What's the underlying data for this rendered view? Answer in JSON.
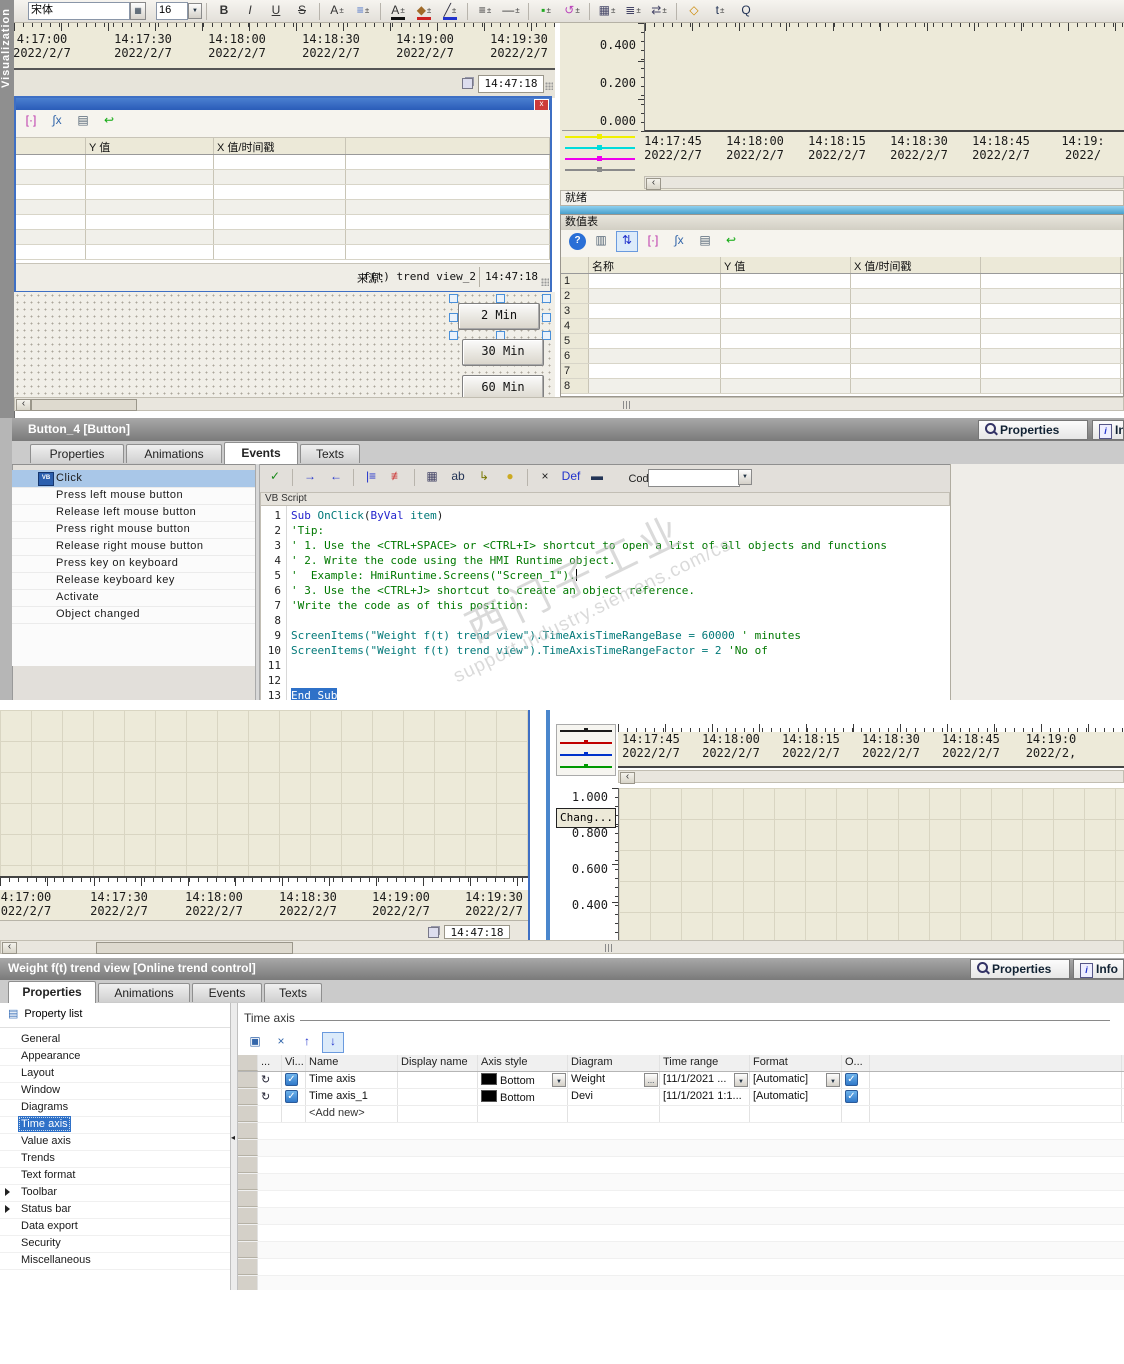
{
  "watermark": {
    "line1": "西门子工业",
    "line2": "support.industry.siemens.com/cs"
  },
  "toolbar": {
    "font_name": "宋体",
    "font_size": "16",
    "icons": [
      {
        "n": "bold-icon",
        "g": "B",
        "b": 1
      },
      {
        "n": "italic-icon",
        "g": "I",
        "i": 1
      },
      {
        "n": "underline-icon",
        "g": "U",
        "u": 1
      },
      {
        "n": "strikethrough-icon",
        "g": "S",
        "s": 1
      },
      {
        "n": "font-grow-icon",
        "g": "A",
        "pm": 1,
        "sep": 1
      },
      {
        "n": "align-icon",
        "g": "≡",
        "c": "#4a72c8",
        "pm": 1
      },
      {
        "n": "font-color-icon",
        "g": "A",
        "bar": "#111",
        "pm": 1,
        "sep": 1
      },
      {
        "n": "highlight-color-icon",
        "g": "◆",
        "c": "#a06a28",
        "bar": "#cc2222",
        "pm": 1
      },
      {
        "n": "pen-color-icon",
        "g": "╱",
        "c": "#334",
        "bar": "#2233cc",
        "pm": 1
      },
      {
        "n": "line-style-icon",
        "g": "≡",
        "pm": 1,
        "sep": 1
      },
      {
        "n": "line-width-icon",
        "g": "—",
        "pm": 1
      },
      {
        "n": "fill-color-icon",
        "g": "▪",
        "c": "#22aa22",
        "pm": 1,
        "sep": 1
      },
      {
        "n": "rotate-icon",
        "g": "↺",
        "c": "#bb44bb",
        "pm": 1
      },
      {
        "n": "grid-icon",
        "g": "▦",
        "c": "#446",
        "pm": 1,
        "sep": 1
      },
      {
        "n": "list-icon",
        "g": "≣",
        "c": "#446",
        "pm": 1
      },
      {
        "n": "flip-icon",
        "g": "⇄",
        "c": "#446",
        "pm": 1
      },
      {
        "n": "format-painter-icon",
        "g": "◇",
        "c": "#cc8800",
        "sep": 1
      },
      {
        "n": "text-rotate-icon",
        "g": "t",
        "c": "#235",
        "pm": 1
      },
      {
        "n": "find-icon",
        "g": "Q",
        "c": "#235"
      }
    ]
  },
  "sidebar": {
    "label": "Visualization"
  },
  "sec1": {
    "left_chart": {
      "labels": [
        {
          "t": "4:17:00",
          "d": "2022/2/7"
        },
        {
          "t": "14:17:30",
          "d": "2022/2/7"
        },
        {
          "t": "14:18:00",
          "d": "2022/2/7"
        },
        {
          "t": "14:18:30",
          "d": "2022/2/7"
        },
        {
          "t": "14:19:00",
          "d": "2022/2/7"
        },
        {
          "t": "14:19:30",
          "d": "2022/2/7"
        }
      ],
      "clock": "14:47:18"
    },
    "left_table": {
      "toolbar": [
        {
          "n": "select-points-icon",
          "g": "[·]",
          "c": "#bb33aa"
        },
        {
          "n": "statistics-icon",
          "g": "∫x",
          "c": "#3366aa"
        },
        {
          "n": "print-icon",
          "g": "▤",
          "c": "#556677"
        },
        {
          "n": "undo-icon",
          "g": "↩",
          "c": "#11aa11"
        }
      ],
      "headers": [
        "",
        "Y 值",
        "X 值/时间戳",
        ""
      ],
      "row_count": 7,
      "source_label": "来源：",
      "source": "f(t) trend view_2",
      "clock": "14:47:18"
    },
    "canvas": {
      "buttons": [
        "2 Min",
        "30 Min",
        "60 Min"
      ]
    },
    "right_chart": {
      "y_labels": [
        "0.400",
        "0.200",
        "0.000"
      ],
      "labels": [
        {
          "t": "14:17:45",
          "d": "2022/2/7"
        },
        {
          "t": "14:18:00",
          "d": "2022/2/7"
        },
        {
          "t": "14:18:15",
          "d": "2022/2/7"
        },
        {
          "t": "14:18:30",
          "d": "2022/2/7"
        },
        {
          "t": "14:18:45",
          "d": "2022/2/7"
        },
        {
          "t": "14:19:",
          "d": "2022/"
        }
      ],
      "legend_colors": [
        "#f0f000",
        "#00dcdc",
        "#ee00ee",
        "#8a8a8a"
      ],
      "status": "就绪"
    },
    "right_table": {
      "title": "数值表",
      "toolbar": [
        {
          "n": "help-icon",
          "g": "?",
          "circ": 1
        },
        {
          "n": "export-icon",
          "g": "▥",
          "c": "#556677"
        },
        {
          "n": "swap-axes-icon",
          "g": "⇅",
          "c": "#2233cc",
          "active": 1
        },
        {
          "n": "select-points-icon",
          "g": "[·]",
          "c": "#bb33aa"
        },
        {
          "n": "statistics-icon",
          "g": "∫x",
          "c": "#3366aa"
        },
        {
          "n": "print-icon",
          "g": "▤",
          "c": "#556677"
        },
        {
          "n": "undo-icon",
          "g": "↩",
          "c": "#11aa11"
        }
      ],
      "headers": [
        "",
        "名称",
        "Y 值",
        "X 值/时间戳",
        ""
      ],
      "row_count": 8
    }
  },
  "button4": {
    "title": "Button_4 [Button]",
    "side_tabs": [
      {
        "label": "Properties"
      },
      {
        "label": "Info"
      }
    ],
    "tabs": [
      {
        "label": "Properties"
      },
      {
        "label": "Animations"
      },
      {
        "label": "Events",
        "active": true
      },
      {
        "label": "Texts"
      }
    ],
    "events": [
      {
        "label": "Click",
        "selected": true
      },
      {
        "label": "Press left mouse button"
      },
      {
        "label": "Release left mouse button"
      },
      {
        "label": "Press right mouse button"
      },
      {
        "label": "Release right mouse button"
      },
      {
        "label": "Press key on keyboard"
      },
      {
        "label": "Release keyboard key"
      },
      {
        "label": "Activate"
      },
      {
        "label": "Object changed"
      }
    ],
    "script_toolbar": {
      "icons": [
        {
          "n": "apply-script-icon",
          "g": "✓",
          "c": "#1a8a1a"
        },
        {
          "n": "indent-icon",
          "g": "→",
          "c": "#2233cc",
          "sep": 1
        },
        {
          "n": "outdent-icon",
          "g": "←",
          "c": "#2233cc"
        },
        {
          "n": "insert-row-icon",
          "g": "|≡",
          "c": "#2233cc",
          "sep": 1
        },
        {
          "n": "delete-row-icon",
          "g": "≢",
          "c": "#cc3333"
        },
        {
          "n": "lookup-table-icon",
          "g": "▦",
          "c": "#446",
          "sep": 1
        },
        {
          "n": "rename-icon",
          "g": "ab",
          "c": "#235"
        },
        {
          "n": "goto-icon",
          "g": "↳",
          "c": "#777700"
        },
        {
          "n": "object-list-icon",
          "g": "●",
          "c": "#ccaa22"
        },
        {
          "n": "delete-script-icon",
          "g": "×",
          "c": "#222",
          "sep": 1
        },
        {
          "n": "definition-icon",
          "g": "Def",
          "c": "#2233cc"
        },
        {
          "n": "snippet-icon",
          "g": "▬",
          "c": "#235"
        }
      ],
      "code_page_label": "Code page"
    },
    "script_type": "VB Script",
    "code": [
      {
        "n": 1,
        "segs": [
          [
            "Sub ",
            "kw"
          ],
          [
            "OnClick",
            "id"
          ],
          [
            "(",
            "tx"
          ],
          [
            "ByVal",
            "kw"
          ],
          [
            " ",
            "tx"
          ],
          [
            "item",
            "id"
          ],
          [
            ")",
            "tx"
          ]
        ]
      },
      {
        "n": 2,
        "segs": [
          [
            "'Tip:",
            "cm"
          ]
        ]
      },
      {
        "n": 3,
        "segs": [
          [
            "' 1. Use the <CTRL+SPACE> or <CTRL+I> shortcut to open a list of all objects and functions",
            "cm"
          ]
        ]
      },
      {
        "n": 4,
        "segs": [
          [
            "' 2. Write the code using the HMI Runtime object.",
            "cm"
          ]
        ]
      },
      {
        "n": 5,
        "segs": [
          [
            "'  Example: HmiRuntime.Screens(\"Screen_1\").",
            "cm"
          ]
        ],
        "caret": true
      },
      {
        "n": 6,
        "segs": [
          [
            "' 3. Use the <CTRL+J> shortcut to create an object reference.",
            "cm"
          ]
        ]
      },
      {
        "n": 7,
        "segs": [
          [
            "'Write the code as of this position:",
            "cm"
          ]
        ]
      },
      {
        "n": 8,
        "segs": []
      },
      {
        "n": 9,
        "segs": [
          [
            "ScreenItems(\"Weight f(t) trend view\").TimeAxisTimeRangeBase = 60000 ",
            "id"
          ],
          [
            "' minutes",
            "cm"
          ]
        ]
      },
      {
        "n": 10,
        "segs": [
          [
            "ScreenItems(\"Weight f(t) trend view\").TimeAxisTimeRangeFactor = 2 ",
            "id"
          ],
          [
            "'No of",
            "cm"
          ]
        ]
      },
      {
        "n": 11,
        "segs": []
      },
      {
        "n": 12,
        "segs": []
      },
      {
        "n": 13,
        "segs": [
          [
            "End Sub",
            "kw"
          ]
        ],
        "selected": true
      }
    ]
  },
  "sec2": {
    "left_chart": {
      "labels": [
        {
          "t": "4:17:00",
          "d": "022/2/7"
        },
        {
          "t": "14:17:30",
          "d": "2022/2/7"
        },
        {
          "t": "14:18:00",
          "d": "2022/2/7"
        },
        {
          "t": "14:18:30",
          "d": "2022/2/7"
        },
        {
          "t": "14:19:00",
          "d": "2022/2/7"
        },
        {
          "t": "14:19:30",
          "d": "2022/2/7"
        }
      ],
      "clock": "14:47:18"
    },
    "right_chart": {
      "y_labels": [
        "1.000",
        "0.800",
        "0.600",
        "0.400"
      ],
      "labels": [
        {
          "t": "14:17:45",
          "d": "2022/2/7"
        },
        {
          "t": "14:18:00",
          "d": "2022/2/7"
        },
        {
          "t": "14:18:15",
          "d": "2022/2/7"
        },
        {
          "t": "14:18:30",
          "d": "2022/2/7"
        },
        {
          "t": "14:18:45",
          "d": "2022/2/7"
        },
        {
          "t": "14:19:0",
          "d": "2022/2,"
        }
      ],
      "legend_colors": [
        "#1a1a1a",
        "#c00000",
        "#0033cc",
        "#009900"
      ],
      "change_button": "Chang..."
    }
  },
  "weight": {
    "title": "Weight f(t) trend view [Online trend control]",
    "side_tabs": [
      {
        "label": "Properties"
      },
      {
        "label": "Info"
      }
    ],
    "tabs": [
      {
        "label": "Properties",
        "active": true
      },
      {
        "label": "Animations"
      },
      {
        "label": "Events"
      },
      {
        "label": "Texts"
      }
    ],
    "property_list": {
      "header": "Property list",
      "items": [
        {
          "label": "General"
        },
        {
          "label": "Appearance"
        },
        {
          "label": "Layout"
        },
        {
          "label": "Window"
        },
        {
          "label": "Diagrams"
        },
        {
          "label": "Time axis",
          "selected": true
        },
        {
          "label": "Value axis"
        },
        {
          "label": "Trends"
        },
        {
          "label": "Text format"
        },
        {
          "label": "Toolbar",
          "expandable": true
        },
        {
          "label": "Status bar",
          "expandable": true
        },
        {
          "label": "Data export"
        },
        {
          "label": "Security"
        },
        {
          "label": "Miscellaneous"
        }
      ]
    },
    "time_axis": {
      "section_label": "Time axis",
      "toolbar": [
        {
          "n": "new-axis-icon",
          "g": "▣",
          "c": "#3366aa"
        },
        {
          "n": "delete-values-icon",
          "g": "×",
          "c": "#3366aa"
        },
        {
          "n": "move-up-icon",
          "g": "↑",
          "c": "#2233cc"
        },
        {
          "n": "move-down-icon",
          "g": "↓",
          "c": "#2233cc",
          "active": 1
        }
      ],
      "columns": [
        "...",
        "Vi...",
        "Name",
        "Display name",
        "Axis style",
        "Diagram",
        "Time range",
        "Format",
        "O..."
      ],
      "rows": [
        {
          "name": "Time axis",
          "display_name": "",
          "axis_style": "Bottom",
          "diagram": "Weight",
          "time_range": "[11/1/2021 ...",
          "format": "[Automatic]",
          "visible": true,
          "enabled": true,
          "focused": true
        },
        {
          "name": "Time axis_1",
          "display_name": "",
          "axis_style": "Bottom",
          "diagram": "Devi",
          "time_range": "[11/1/2021 1:1...",
          "format": "[Automatic]",
          "visible": true,
          "enabled": true
        },
        {
          "name": "<Add new>",
          "add_new": true
        }
      ]
    }
  }
}
